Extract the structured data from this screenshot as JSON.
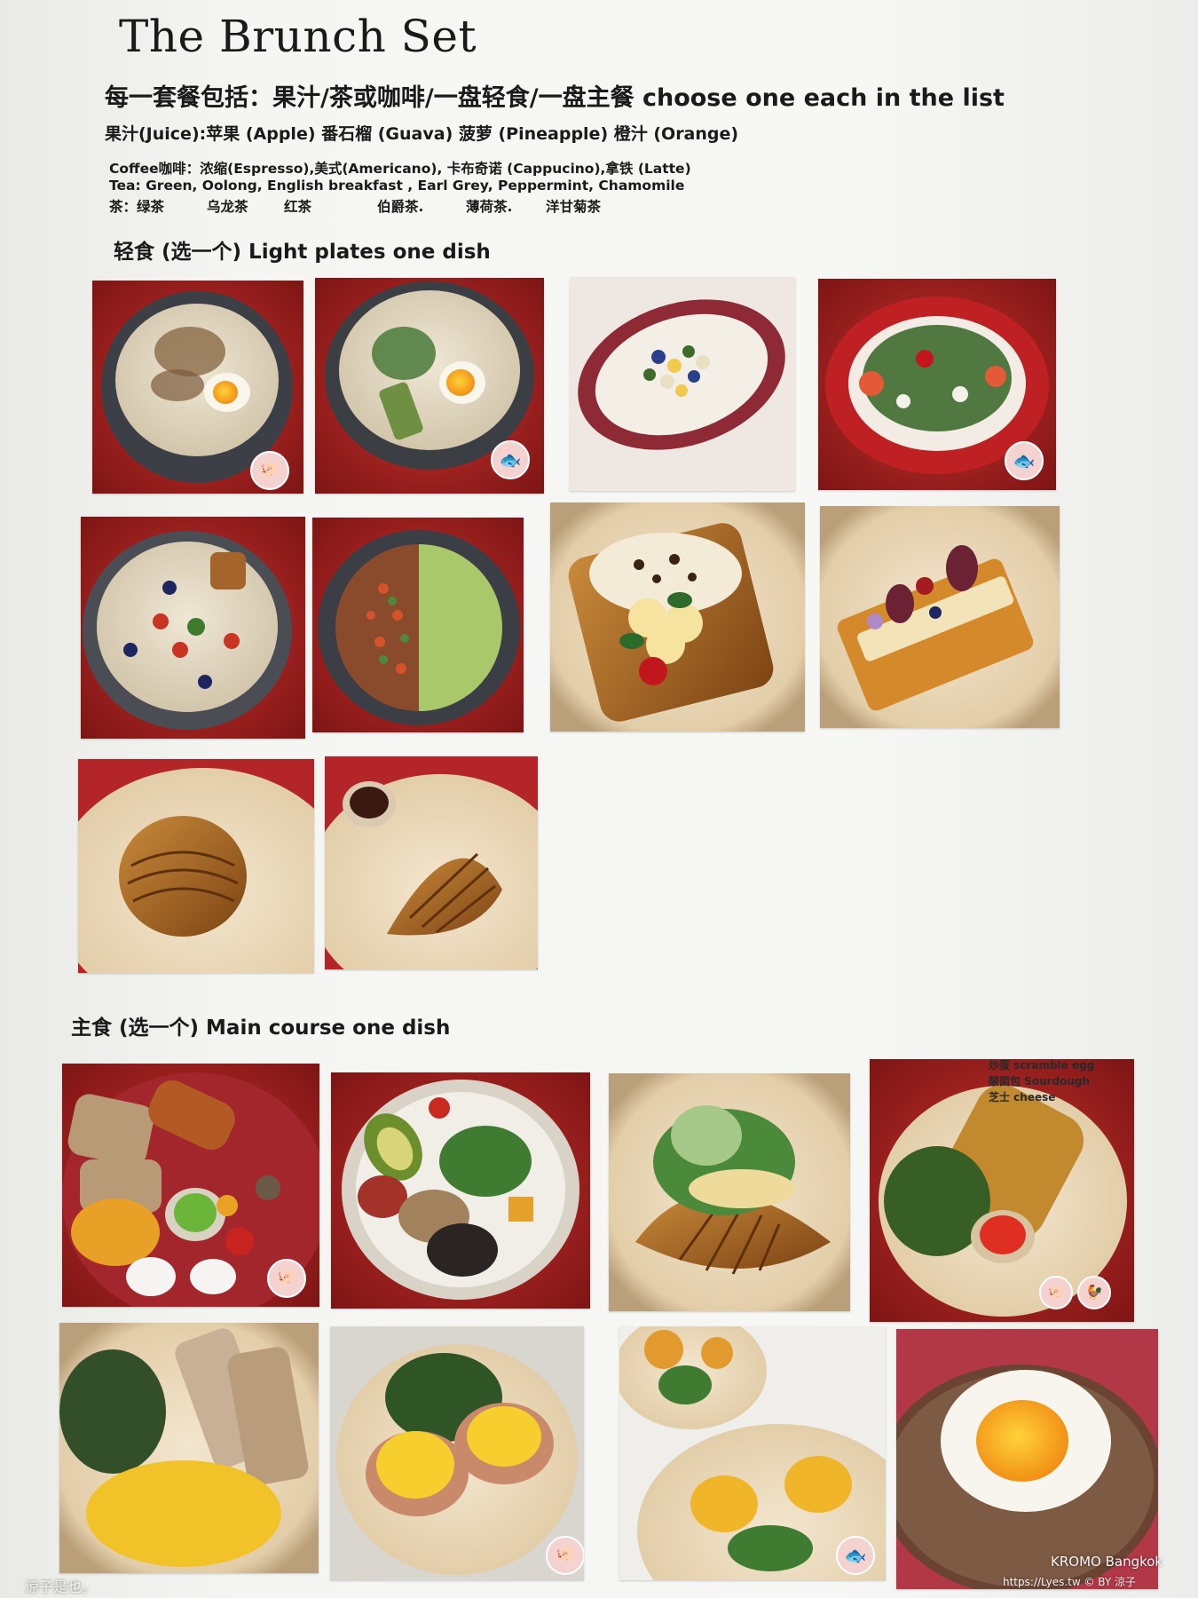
{
  "menu": {
    "title": "The Brunch Set",
    "subtitle": "每一套餐包括：果汁/茶或咖啡/一盘轻食/一盘主餐 choose one each in the list",
    "juice_line": "果汁(Juice):苹果 (Apple)   番石榴 (Guava) 菠萝 (Pineapple) 橙汁 (Orange)",
    "coffee_line": "Coffee咖啡：浓缩(Espresso),美式(Americano), 卡布奇诺 (Cappucino),拿铁 (Latte)",
    "tea_line_en": "Tea: Green, Oolong, English breakfast , Earl Grey, Peppermint, Chamomile",
    "tea_line_zh": [
      "茶：绿茶",
      "乌龙茶",
      "红茶",
      "伯爵茶.",
      "薄荷茶.",
      "洋甘菊茶"
    ],
    "light_section": "轻食 (选一个) Light plates one dish",
    "main_section": "主食 (选一个) Main course one dish"
  },
  "photo_overlay": {
    "main4_lines": [
      "炒蛋 scramble egg",
      "酸面包 Sourdough",
      "芝士 cheese"
    ]
  },
  "watermark": {
    "left": "涼子是也。",
    "brand": "KROMO Bangkok",
    "url": "https://Lyes.tw © BY 涼子"
  },
  "icons": {
    "pork": "pig-icon",
    "fish": "fish-icon",
    "chicken": "chicken-icon"
  }
}
